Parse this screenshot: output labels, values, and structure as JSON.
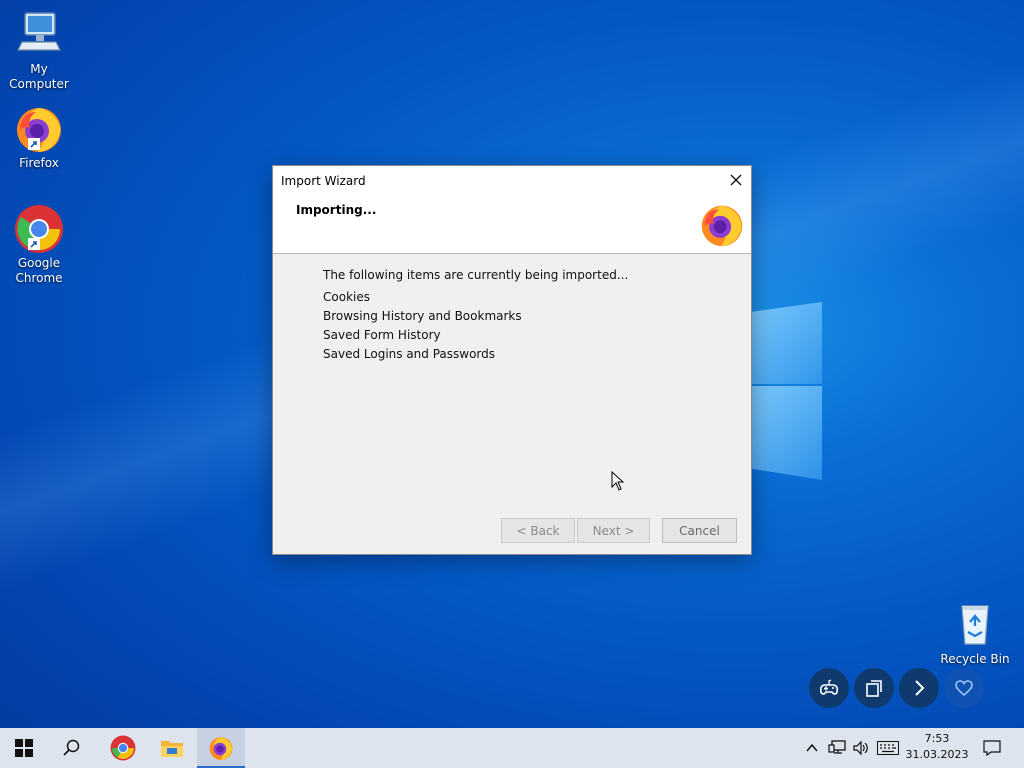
{
  "desktop": {
    "icons": [
      {
        "label": "My Computer",
        "icon": "computer-icon"
      },
      {
        "label": "Firefox",
        "icon": "firefox-icon"
      },
      {
        "label": "Google Chrome",
        "icon": "chrome-icon"
      },
      {
        "label": "Recycle Bin",
        "icon": "recycle-bin-icon"
      }
    ]
  },
  "dialog": {
    "title": "Import Wizard",
    "close_label": "✕",
    "heading": "Importing...",
    "intro": "The following items are currently being imported...",
    "items": [
      "Cookies",
      "Browsing History and Bookmarks",
      "Saved Form History",
      "Saved Logins and Passwords"
    ],
    "buttons": {
      "back": "< Back",
      "next": "Next >",
      "cancel": "Cancel"
    }
  },
  "overlay_controls": [
    "gamepad-icon",
    "window-switch-icon",
    "chevron-right-icon",
    "heart-icon"
  ],
  "taskbar": {
    "apps": [
      "start-icon",
      "search-icon",
      "chrome-icon",
      "file-explorer-icon",
      "firefox-icon"
    ],
    "active_app": "firefox-icon",
    "tray": [
      "chevron-up-icon",
      "network-icon",
      "volume-icon",
      "keyboard-icon"
    ],
    "time": "7:53",
    "date": "31.03.2023",
    "notification_icon": "notification-icon"
  },
  "colors": {
    "wallpaper": "#0457c4",
    "taskbar": "#dde4ee",
    "dialog_bg": "#f0f0f0",
    "control_button": "#0f3a6e"
  }
}
